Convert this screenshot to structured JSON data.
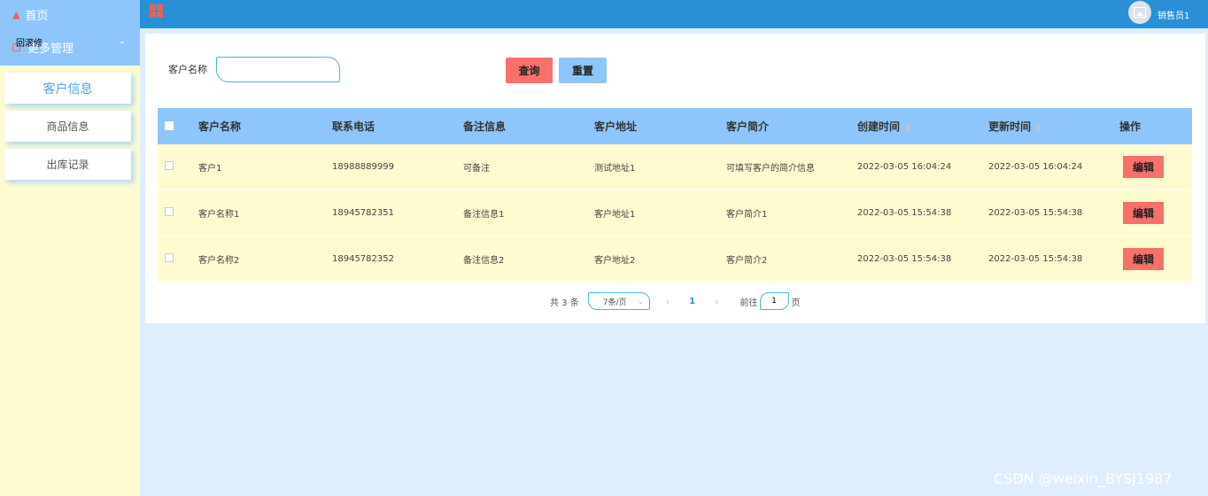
{
  "sidebar": {
    "home_label": "首页",
    "group_label": "更多管理",
    "tooltip": "回滚修",
    "items": [
      {
        "label": "客户信息",
        "active": true
      },
      {
        "label": "商品信息",
        "active": false
      },
      {
        "label": "出库记录",
        "active": false
      }
    ]
  },
  "header": {
    "username": "销售员1"
  },
  "search": {
    "label": "客户名称",
    "value": "",
    "placeholder": "",
    "query_label": "查询",
    "reset_label": "重置"
  },
  "table": {
    "columns": [
      "客户名称",
      "联系电话",
      "备注信息",
      "客户地址",
      "客户简介",
      "创建时间",
      "更新时间",
      "操作"
    ],
    "rows": [
      {
        "name": "客户1",
        "phone": "18988889999",
        "note": "可备注",
        "address": "测试地址1",
        "intro": "可填写客户的简介信息",
        "created": "2022-03-05 16:04:24",
        "updated": "2022-03-05 16:04:24",
        "action": "编辑"
      },
      {
        "name": "客户名称1",
        "phone": "18945782351",
        "note": "备注信息1",
        "address": "客户地址1",
        "intro": "客户简介1",
        "created": "2022-03-05 15:54:38",
        "updated": "2022-03-05 15:54:38",
        "action": "编辑"
      },
      {
        "name": "客户名称2",
        "phone": "18945782352",
        "note": "备注信息2",
        "address": "客户地址2",
        "intro": "客户简介2",
        "created": "2022-03-05 15:54:38",
        "updated": "2022-03-05 15:54:38",
        "action": "编辑"
      }
    ]
  },
  "pagination": {
    "total_text": "共 3 条",
    "page_size": "7条/页",
    "current_page": "1",
    "goto_label": "前往",
    "goto_value": "1",
    "page_unit": "页"
  },
  "watermark": "CSDN @weixin_BYSJ1987",
  "colors": {
    "header": "#2b8fd6",
    "sidebar": "#fefbd0",
    "nav": "#8ec6fb",
    "danger": "#f7716a"
  }
}
